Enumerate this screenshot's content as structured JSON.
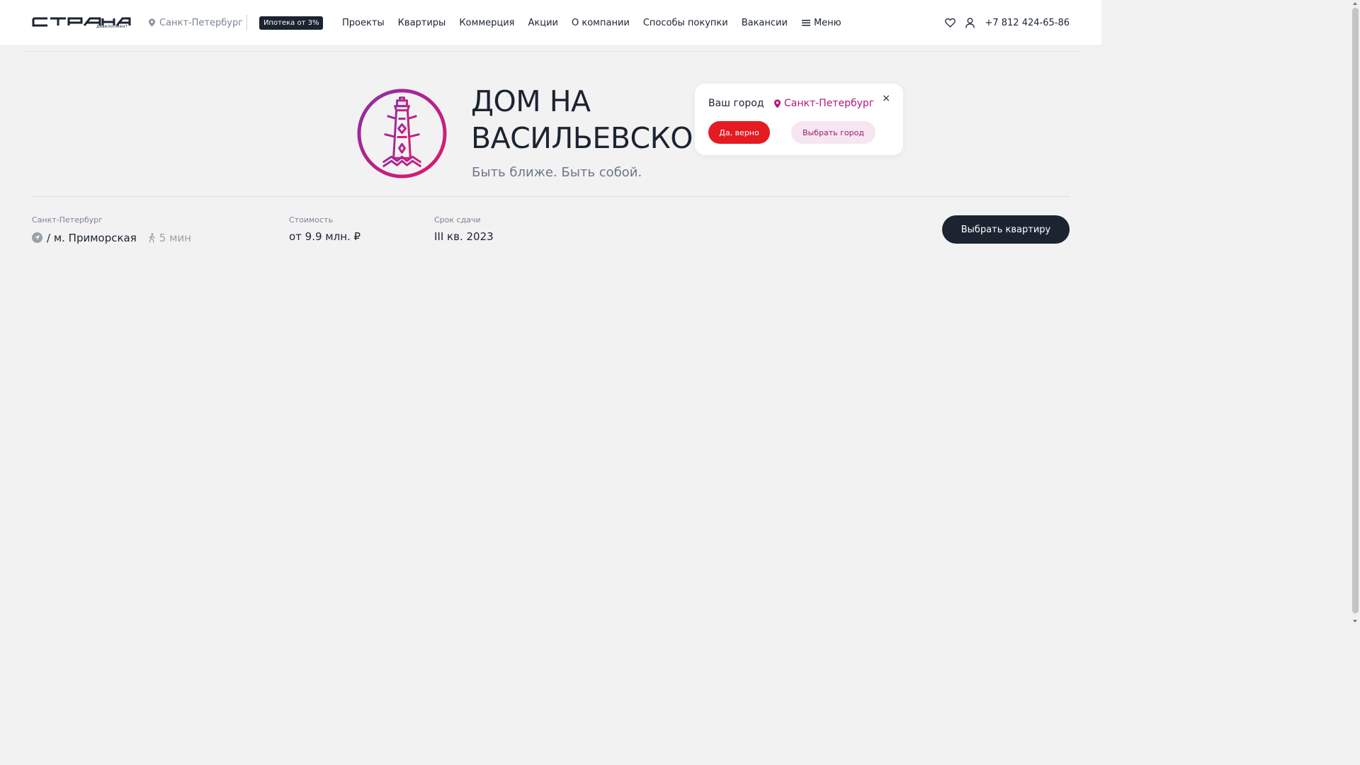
{
  "header": {
    "logo_caption": "девелопмент",
    "city": "Санкт-Петербург",
    "mortgage_badge": "Ипотека от 3%",
    "nav": {
      "projects": "Проекты",
      "flats": "Квартиры",
      "commerce": "Коммерция",
      "promo": "Акции",
      "about": "О компании",
      "buy": "Способы покупки",
      "jobs": "Вакансии",
      "menu": "Меню"
    },
    "phone": "+7 812 424-65-86",
    "icons": {
      "city": "map-pin-icon",
      "menu": "hamburger-icon",
      "favorites": "heart-icon",
      "account": "user-icon"
    }
  },
  "hero": {
    "title_line1": "ДОМ НА",
    "title_line2": "ВАСИЛЬЕВСКОМ",
    "subtitle": "Быть ближе. Быть собой.",
    "emblem_color": "#b8187a"
  },
  "city_popup": {
    "question": "Ваш город",
    "city": "Санкт-Петербург",
    "close": "×",
    "yes_button": "Да, верно",
    "choose_button": "Выбрать город"
  },
  "info": {
    "location_label": "Санкт-Петербург",
    "metro": "/ м. Приморская",
    "walk_time": "5 мин",
    "price_label": "Стоимость",
    "price_value": "от 9.9 млн. ₽",
    "deadline_label": "Срок сдачи",
    "deadline_value": "III кв. 2023",
    "cta_button": "Выбрать квартиру"
  },
  "colors": {
    "dark": "#1b2430",
    "accent_red": "#e51b22",
    "accent_magenta": "#b3167d",
    "background": "#f2f2f3"
  }
}
